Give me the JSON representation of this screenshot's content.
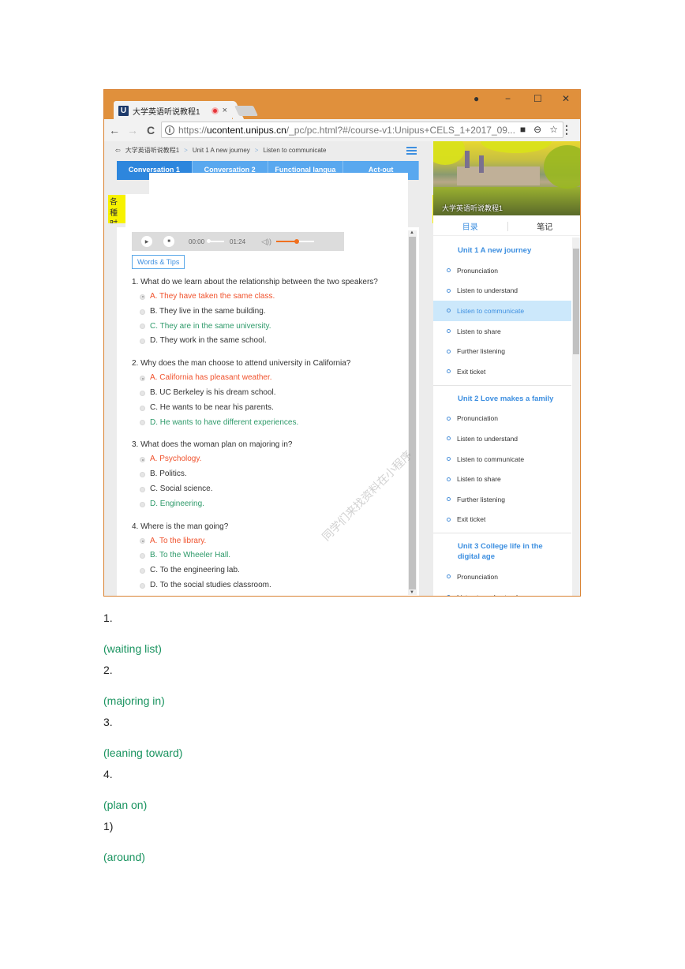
{
  "browser": {
    "tab_title": "大学英语听说教程1",
    "favicon_letter": "U",
    "tab_close": "×",
    "url_scheme": "https://",
    "url_domain": "ucontent.unipus.cn",
    "url_rest": "/_pc/pc.html?#/course-v1:Unipus+CELS_1+2017_09...",
    "icons": {
      "back": "←",
      "forward": "→",
      "reload": "C",
      "info": "i",
      "camera": "■",
      "zoom": "⊖",
      "star": "☆",
      "menu": "⋮",
      "account": "●",
      "minimize": "−",
      "maximize": "☐",
      "close": "✕"
    }
  },
  "breadcrumb": {
    "back_icon": "⇦",
    "items": [
      "大学英语听说教程1",
      "Unit 1 A new journey",
      "Listen to communicate"
    ],
    "sep": ">"
  },
  "conv_tabs": [
    "Conversation 1",
    "Conversation 2",
    "Functional langua",
    "Act-out"
  ],
  "yellow_note": "各種\n时点",
  "player": {
    "play_icon": "▶",
    "stop_icon": "■",
    "current_time": "00:00",
    "duration": "01:24",
    "volume_icon": "◁))",
    "volume_level": 0.55
  },
  "words_tips": "Words & Tips",
  "questions": [
    {
      "text": "1. What do we learn about the relationship between the two speakers?",
      "options": [
        {
          "label": "A. They have taken the same class.",
          "status": "wrong",
          "checked": true
        },
        {
          "label": "B. They live in the same building.",
          "status": "normal",
          "checked": false
        },
        {
          "label": "C. They are in the same university.",
          "status": "correct",
          "checked": false
        },
        {
          "label": "D. They work in the same school.",
          "status": "normal",
          "checked": false
        }
      ]
    },
    {
      "text": "2. Why does the man choose to attend university in California?",
      "options": [
        {
          "label": "A. California has pleasant weather.",
          "status": "wrong",
          "checked": true
        },
        {
          "label": "B. UC Berkeley is his dream school.",
          "status": "normal",
          "checked": false
        },
        {
          "label": "C. He wants to be near his parents.",
          "status": "normal",
          "checked": false
        },
        {
          "label": "D. He wants to have different experiences.",
          "status": "correct",
          "checked": false
        }
      ]
    },
    {
      "text": "3. What does the woman plan on majoring in?",
      "options": [
        {
          "label": "A. Psychology.",
          "status": "wrong",
          "checked": true
        },
        {
          "label": "B. Politics.",
          "status": "normal",
          "checked": false
        },
        {
          "label": "C. Social science.",
          "status": "normal",
          "checked": false
        },
        {
          "label": "D. Engineering.",
          "status": "correct",
          "checked": false
        }
      ]
    },
    {
      "text": "4. Where is the man going?",
      "options": [
        {
          "label": "A. To the library.",
          "status": "wrong",
          "checked": true
        },
        {
          "label": "B. To the Wheeler Hall.",
          "status": "correct",
          "checked": false
        },
        {
          "label": "C. To the engineering lab.",
          "status": "normal",
          "checked": false
        },
        {
          "label": "D. To the social studies classroom.",
          "status": "normal",
          "checked": false
        }
      ]
    }
  ],
  "sidebar": {
    "hero_title": "大学英语听说教程1",
    "tabs": [
      "目录",
      "笔记"
    ],
    "units": [
      {
        "title": "Unit 1 A new journey",
        "items": [
          "Pronunciation",
          "Listen to understand",
          "Listen to communicate",
          "Listen to share",
          "Further listening",
          "Exit ticket"
        ],
        "active": 2
      },
      {
        "title": "Unit 2 Love makes a family",
        "items": [
          "Pronunciation",
          "Listen to understand",
          "Listen to communicate",
          "Listen to share",
          "Further listening",
          "Exit ticket"
        ],
        "active": -1
      },
      {
        "title": "Unit 3 College life in the digital age",
        "items": [
          "Pronunciation",
          "Listen to understand"
        ],
        "active": -1
      }
    ]
  },
  "watermark": "同学们来找资料在小程序",
  "answers": [
    {
      "num": "1.",
      "value": "(waiting list)"
    },
    {
      "num": "2.",
      "value": "(majoring in)"
    },
    {
      "num": "3.",
      "value": "(leaning toward)"
    },
    {
      "num": "4.",
      "value": "(plan on)"
    },
    {
      "num": "1)",
      "value": "(around)"
    }
  ],
  "colors": {
    "wrong": "#f0522d",
    "correct": "#2e9a6a",
    "accent": "#3d8fe0",
    "chrome": "#e0903c"
  }
}
